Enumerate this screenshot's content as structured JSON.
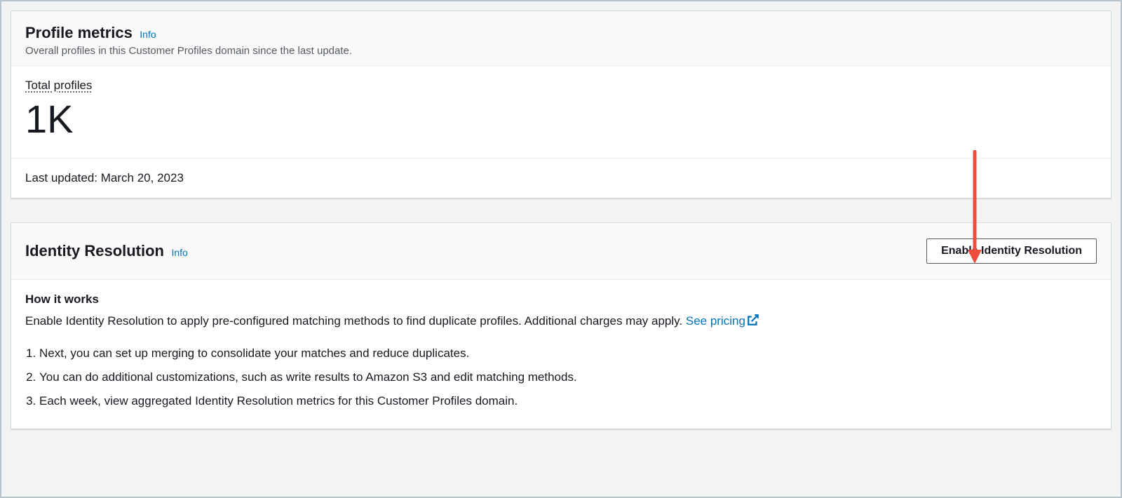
{
  "profile_metrics": {
    "title": "Profile metrics",
    "info_label": "Info",
    "subtitle": "Overall profiles in this Customer Profiles domain since the last update.",
    "total_profiles_label": "Total profiles",
    "total_profiles_value": "1K",
    "last_updated_label": "Last updated: ",
    "last_updated_value": "March 20, 2023"
  },
  "identity_resolution": {
    "title": "Identity Resolution",
    "info_label": "Info",
    "enable_button_label": "Enable Identity Resolution",
    "how_it_works_title": "How it works",
    "how_it_works_text": "Enable Identity Resolution to apply pre-configured matching methods to find duplicate profiles. Additional charges may apply. ",
    "see_pricing_label": "See pricing",
    "steps": [
      "Next, you can set up merging to consolidate your matches and reduce duplicates.",
      "You can do additional customizations, such as write results to Amazon S3 and edit matching methods.",
      "Each week, view aggregated Identity Resolution metrics for this Customer Profiles domain."
    ]
  }
}
